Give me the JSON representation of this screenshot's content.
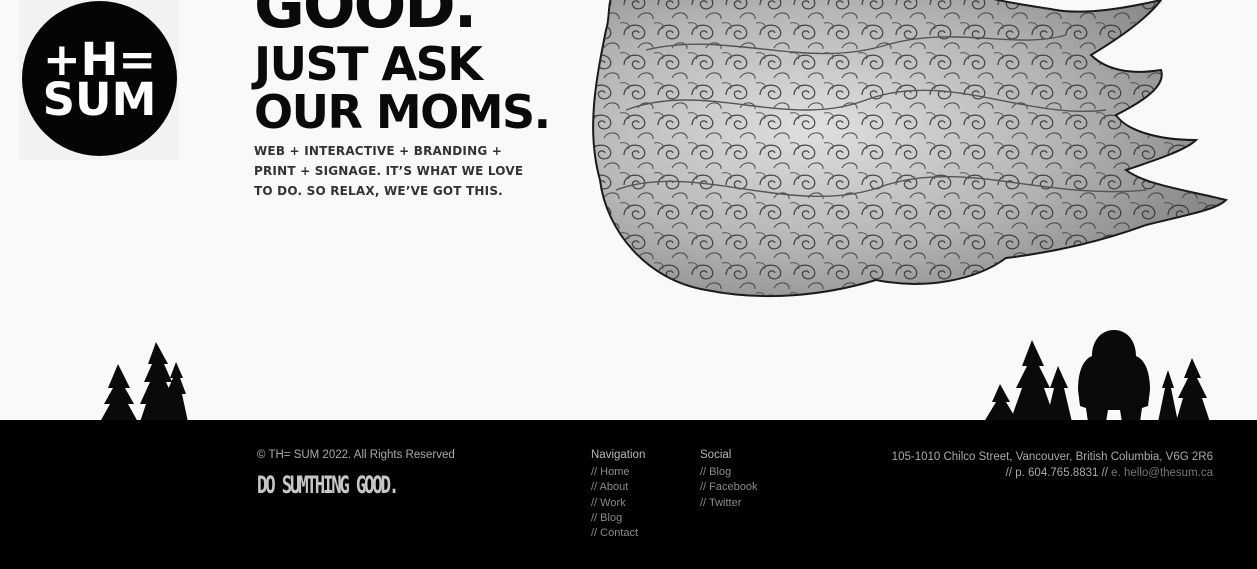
{
  "hero": {
    "logo_line1": "+H=",
    "logo_line2": "SUM",
    "headline_1": "GOOD.",
    "headline_2": "JUST ASK",
    "headline_3": "OUR MOMS.",
    "tagline": "WEB + INTERACTIVE + BRANDING + PRINT + SIGNAGE. IT’S WHAT WE LOVE TO DO. SO RELAX, WE’VE GOT THIS."
  },
  "footer": {
    "copyright": "© TH= SUM 2022. All Rights Reserved",
    "slogan": "DO SUMTHING GOOD.",
    "navigation": {
      "title": "Navigation",
      "links": [
        "// Home",
        "// About",
        "// Work",
        "// Blog",
        "// Contact"
      ]
    },
    "social": {
      "title": "Social",
      "links": [
        "// Blog",
        "// Facebook",
        "// Twitter"
      ]
    },
    "address": "105-1010 Chilco Street, Vancouver, British Columbia, V6G 2R6",
    "phone": "// p. 604.765.8831 //",
    "email_prefix": "e.",
    "email": "hello@thesum.ca"
  },
  "colors": {
    "background": "#f9f9f9",
    "footer_background": "#000000",
    "ink": "#0a0a0a"
  }
}
